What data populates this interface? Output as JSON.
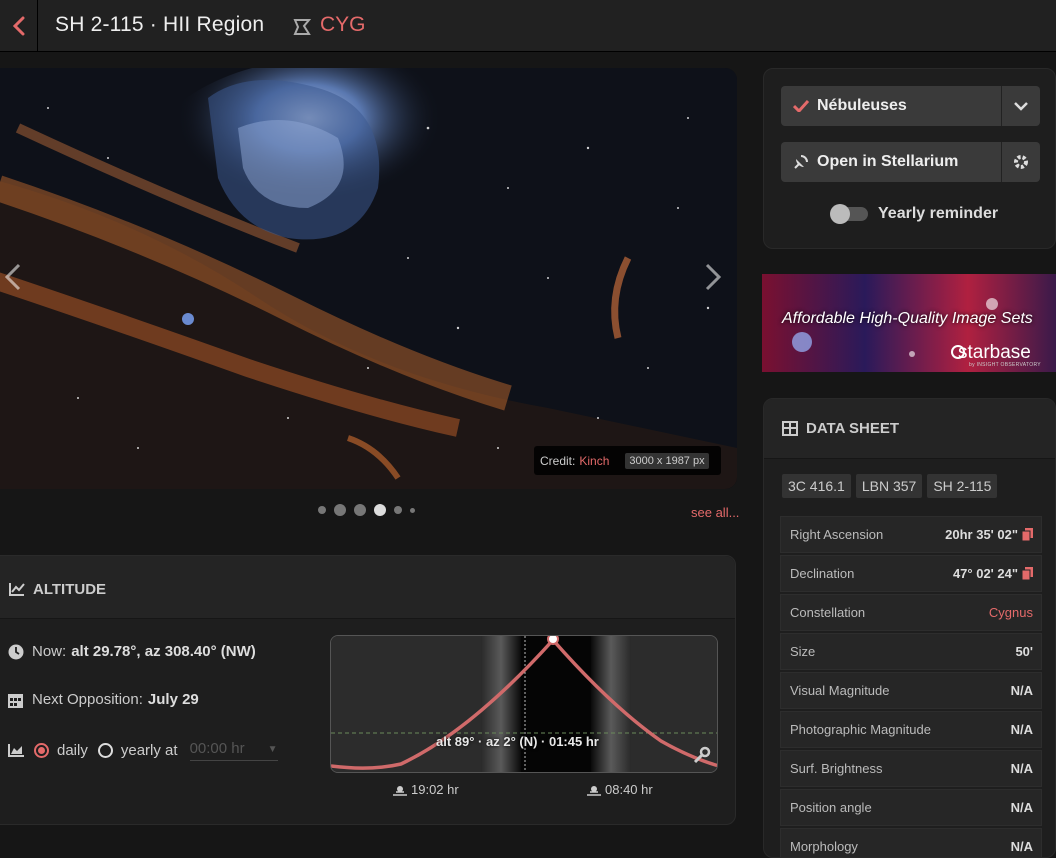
{
  "header": {
    "title": "SH 2-115 · HII Region",
    "constellation": "CYG"
  },
  "image": {
    "credit_label": "Credit:",
    "credit_name": "Kinch",
    "dimensions": "3000 x 1987 px",
    "see_all": "see all..."
  },
  "altitude": {
    "title": "ALTITUDE",
    "now_label": "Now:",
    "now_value": "alt 29.78°, az 308.40° (NW)",
    "opposition_label": "Next Opposition:",
    "opposition_value": "July 29",
    "mode_daily": "daily",
    "mode_yearly": "yearly at",
    "time_placeholder": "00:00 hr",
    "graph_label": "alt 89° · az 2° (N) · 01:45 hr",
    "rise": "19:02 hr",
    "set": "08:40 hr"
  },
  "actions": {
    "list_button": "Nébuleuses",
    "stellarium_button": "Open in Stellarium",
    "reminder_label": "Yearly reminder"
  },
  "ad": {
    "tagline": "Affordable High-Quality Image Sets",
    "brand": "starbase",
    "brand_sub": "by INSIGHT OBSERVATORY"
  },
  "datasheet": {
    "title": "DATA SHEET",
    "aliases": [
      "3C 416.1",
      "LBN 357",
      "SH 2-115"
    ],
    "rows": [
      {
        "key": "Right Ascension",
        "value": "20hr 35' 02\""
      },
      {
        "key": "Declination",
        "value": "47° 02' 24\""
      },
      {
        "key": "Constellation",
        "value": "Cygnus"
      },
      {
        "key": "Size",
        "value": "50'"
      },
      {
        "key": "Visual Magnitude",
        "value": "N/A"
      },
      {
        "key": "Photographic Magnitude",
        "value": "N/A"
      },
      {
        "key": "Surf. Brightness",
        "value": "N/A"
      },
      {
        "key": "Position angle",
        "value": "N/A"
      },
      {
        "key": "Morphology",
        "value": "N/A"
      }
    ]
  },
  "colors": {
    "accent": "#e46a6a",
    "background": "#161616",
    "panel": "#1e1e1e"
  }
}
